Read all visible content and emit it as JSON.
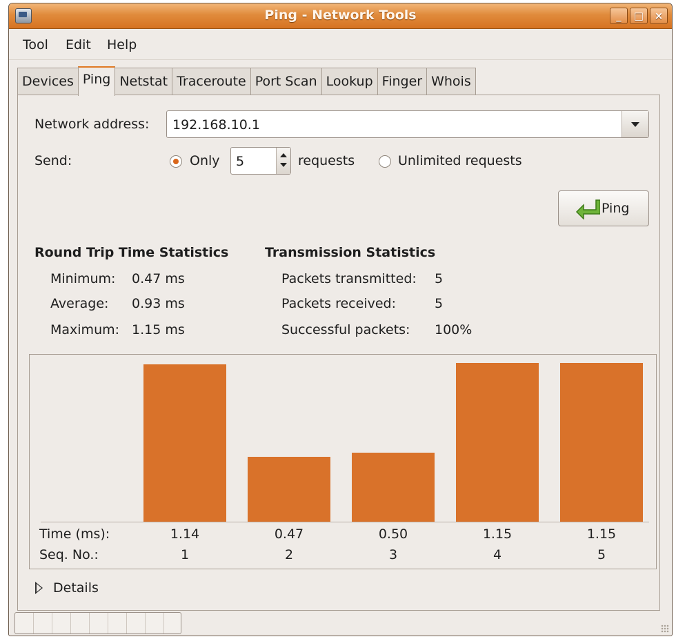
{
  "window": {
    "title": "Ping - Network Tools"
  },
  "menubar": {
    "items": [
      "Tool",
      "Edit",
      "Help"
    ]
  },
  "tabs": [
    "Devices",
    "Ping",
    "Netstat",
    "Traceroute",
    "Port Scan",
    "Lookup",
    "Finger",
    "Whois"
  ],
  "active_tab": "Ping",
  "form": {
    "address_label": "Network address:",
    "address_value": "192.168.10.1",
    "send_label": "Send:",
    "only_label": "Only",
    "count_value": "5",
    "requests_label": "requests",
    "unlimited_label": "Unlimited requests",
    "only_selected": true
  },
  "ping_button": {
    "label": "Ping"
  },
  "rtt": {
    "heading": "Round Trip Time Statistics",
    "rows": [
      {
        "label": "Minimum:",
        "value": "0.47 ms"
      },
      {
        "label": "Average:",
        "value": "0.93 ms"
      },
      {
        "label": "Maximum:",
        "value": "1.15 ms"
      }
    ]
  },
  "transmission": {
    "heading": "Transmission Statistics",
    "rows": [
      {
        "label": "Packets transmitted:",
        "value": "5"
      },
      {
        "label": "Packets received:",
        "value": "5"
      },
      {
        "label": "Successful packets:",
        "value": "100%"
      }
    ]
  },
  "colors": {
    "bar": "#d9722a",
    "accent": "#e07a24"
  },
  "chart_data": {
    "type": "bar",
    "row_labels": [
      "Time (ms):",
      "Seq. No.:"
    ],
    "categories": [
      "1",
      "2",
      "3",
      "4",
      "5"
    ],
    "values": [
      1.14,
      0.47,
      0.5,
      1.15,
      1.15
    ],
    "value_labels": [
      "1.14",
      "0.47",
      "0.50",
      "1.15",
      "1.15"
    ],
    "ylim": [
      0,
      1.15
    ]
  },
  "details": {
    "label": "Details"
  }
}
